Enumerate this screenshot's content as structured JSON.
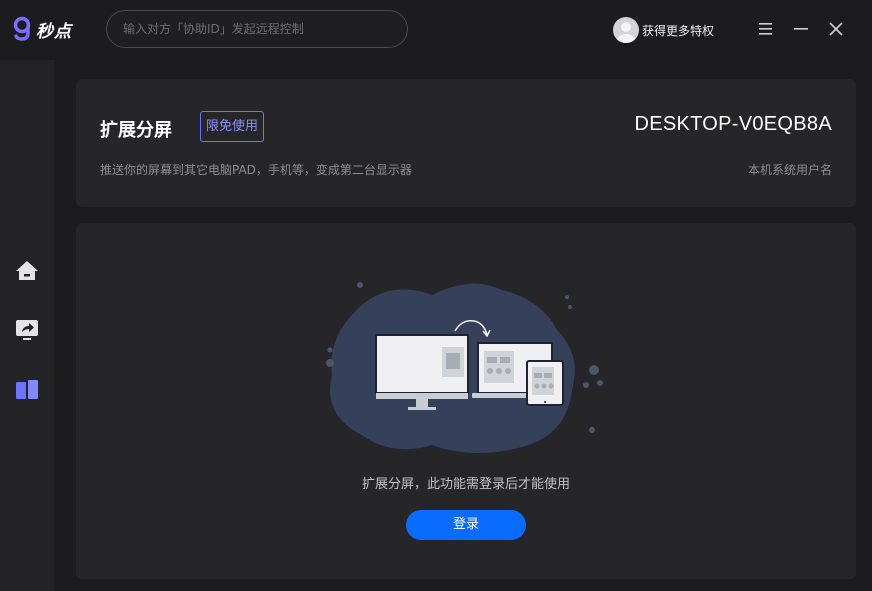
{
  "app": {
    "name": "秒点"
  },
  "search": {
    "placeholder": "输入对方「协助ID」发起远程控制"
  },
  "user": {
    "label": "获得更多特权"
  },
  "window_controls": [
    "menu-icon",
    "minimize-icon",
    "close-icon"
  ],
  "sidebar": {
    "items": [
      {
        "icon": "home-icon"
      },
      {
        "icon": "screen-share-icon"
      },
      {
        "icon": "extend-screen-icon",
        "active": true
      }
    ]
  },
  "header_card": {
    "title": "扩展分屏",
    "badge": "限免使用",
    "description": "推送你的屏幕到其它电脑PAD，手机等，变成第二台显示器",
    "device_name": "DESKTOP-V0EQB8A",
    "device_label": "本机系统用户名"
  },
  "main_card": {
    "message": "扩展分屏，此功能需登录后才能使用",
    "login_button": "登录"
  },
  "colors": {
    "accent": "#0a6cff",
    "badge": "#6b73ff",
    "active_icon": "#6b73ff",
    "background": "#1c1c1e",
    "card": "#262628"
  }
}
